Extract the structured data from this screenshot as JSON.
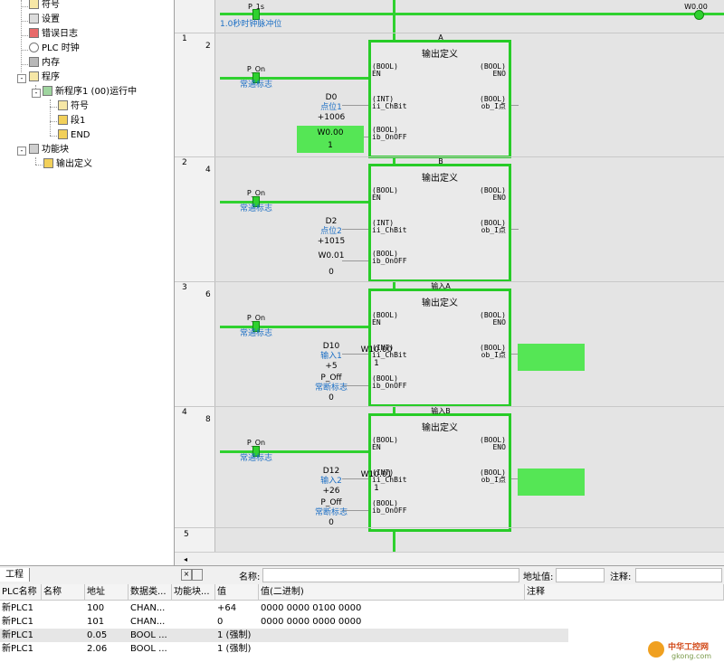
{
  "tree": {
    "items": [
      {
        "label": "符号",
        "icon": "symbol-icon"
      },
      {
        "label": "设置",
        "icon": "settings-icon"
      },
      {
        "label": "错误日志",
        "icon": "error-log-icon"
      },
      {
        "label": "PLC 时钟",
        "icon": "clock-icon"
      },
      {
        "label": "内存",
        "icon": "memory-icon"
      },
      {
        "label": "程序",
        "icon": "programs-icon"
      },
      {
        "label": "新程序1 (00)运行中",
        "icon": "program-icon"
      },
      {
        "label": "符号",
        "icon": "symbol-icon"
      },
      {
        "label": "段1",
        "icon": "section-icon"
      },
      {
        "label": "END",
        "icon": "end-icon"
      },
      {
        "label": "功能块",
        "icon": "function-block-icon"
      },
      {
        "label": "输出定义",
        "icon": "fb-definition-icon"
      }
    ],
    "toggles": [
      "-",
      "-",
      "-"
    ]
  },
  "ladder": {
    "top": {
      "contact": "P_1s",
      "comment": "1.0秒时钟脉冲位",
      "coil": "W0.00"
    },
    "rungs": [
      {
        "rung_no": "1",
        "step": "2",
        "fb_instance": "A",
        "fb_type": "输出定义",
        "contact": "P_On",
        "contact_comment": "常通标志",
        "in_addr": "D0",
        "in_comment": "点位1",
        "in_value": "+1006",
        "off_addr": "W0.00",
        "off_value": "1",
        "out_addr": "",
        "out_value": ""
      },
      {
        "rung_no": "2",
        "step": "4",
        "fb_instance": "B",
        "fb_type": "输出定义",
        "contact": "P_On",
        "contact_comment": "常通标志",
        "in_addr": "D2",
        "in_comment": "点位2",
        "in_value": "+1015",
        "off_addr": "W0.01",
        "off_value": "0",
        "out_addr": "",
        "out_value": ""
      },
      {
        "rung_no": "3",
        "step": "6",
        "fb_instance": "输入A",
        "fb_type": "输出定义",
        "contact": "P_On",
        "contact_comment": "常通标志",
        "in_addr": "D10",
        "in_comment": "输入1",
        "in_value": "+5",
        "off_addr": "P_Off",
        "off_comment": "常断标志",
        "off_value": "0",
        "out_addr": "W10.00",
        "out_value": "1"
      },
      {
        "rung_no": "4",
        "step": "8",
        "fb_instance": "输入B",
        "fb_type": "输出定义",
        "contact": "P_On",
        "contact_comment": "常通标志",
        "in_addr": "D12",
        "in_comment": "输入2",
        "in_value": "+26",
        "off_addr": "P_Off",
        "off_comment": "常断标志",
        "off_value": "0",
        "out_addr": "W10.01",
        "out_value": "1"
      }
    ],
    "pins": {
      "en": "(BOOL)\nEN",
      "eno": "(BOOL)\nENO",
      "chbit": "(INT)\nii_ChBit",
      "obi": "(BOOL)\nob_I点",
      "onoff": "(BOOL)\nib_OnOFF"
    },
    "last_rung": "5"
  },
  "tabs": {
    "active": "工程"
  },
  "watch_bar": {
    "name_label": "名称:",
    "addr_label": "地址值:",
    "comment_label": "注释:"
  },
  "table": {
    "headers": [
      "PLC名称",
      "名称",
      "地址",
      "数据类...",
      "功能块...",
      "值",
      "值(二进制)",
      "注释"
    ],
    "rows": [
      [
        "新PLC1",
        "",
        "100",
        "CHAN...",
        "",
        "+64",
        "0000 0000 0100 0000",
        ""
      ],
      [
        "新PLC1",
        "",
        "101",
        "CHAN...",
        "",
        "0",
        "0000 0000 0000 0000",
        ""
      ],
      [
        "新PLC1",
        "",
        "0.05",
        "BOOL ...",
        "",
        "1 (强制)",
        "",
        ""
      ],
      [
        "新PLC1",
        "",
        "2.06",
        "BOOL ...",
        "",
        "1 (强制)",
        "",
        ""
      ]
    ]
  },
  "watermark": {
    "text": "中华工控网",
    "sub": "gkong.com"
  },
  "colors": {
    "active_green": "#2fd12f",
    "fb_border": "#27cc27",
    "value_box": "#55e655",
    "comment_blue": "#1c6fc5"
  }
}
